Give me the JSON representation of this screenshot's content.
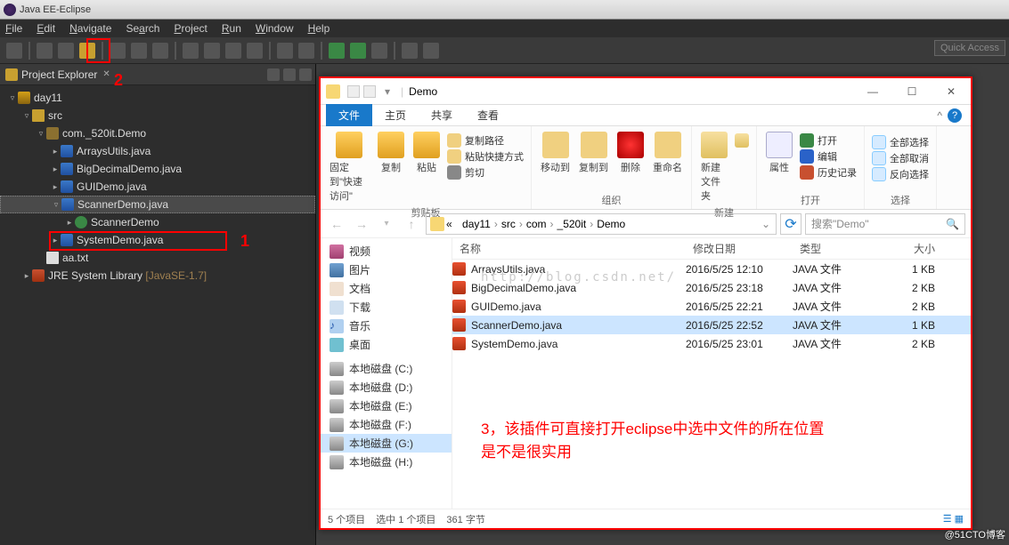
{
  "title": {
    "appname": "Java EE",
    "separator": " - ",
    "ide": "Eclipse"
  },
  "menu": [
    "File",
    "Edit",
    "Navigate",
    "Search",
    "Project",
    "Run",
    "Window",
    "Help"
  ],
  "quick_access": "Quick Access",
  "annotations": {
    "a1": "1",
    "a2": "2",
    "a3_line1": "3，该插件可直接打开eclipse中选中文件的所在位置",
    "a3_line2": "是不是很实用"
  },
  "pe": {
    "title": "Project Explorer"
  },
  "tree": {
    "project": "day11",
    "src": "src",
    "pkg": "com._520it.Demo",
    "files": [
      "ArraysUtils.java",
      "BigDecimalDemo.java",
      "GUIDemo.java",
      "ScannerDemo.java",
      "SystemDemo.java"
    ],
    "inner": "ScannerDemo",
    "txt": "aa.txt",
    "jre_lbl": "JRE System Library",
    "jre_ver": "[JavaSE-1.7]"
  },
  "explorer": {
    "title": "Demo",
    "tabs": [
      "文件",
      "主页",
      "共享",
      "查看"
    ],
    "ribbon": {
      "pin": "固定到\"快速访问\"",
      "copy": "复制",
      "paste": "粘贴",
      "cut": "剪切",
      "copypath": "复制路径",
      "pasteshort": "粘贴快捷方式",
      "clip_grp": "剪贴板",
      "moveto": "移动到",
      "copyto": "复制到",
      "delete": "删除",
      "rename": "重命名",
      "org_grp": "组织",
      "newfolder": "新建文件夹",
      "new_grp": "新建",
      "props": "属性",
      "open": "打开",
      "edit": "编辑",
      "history": "历史记录",
      "open_grp": "打开",
      "selall": "全部选择",
      "selnone": "全部取消",
      "selinv": "反向选择",
      "sel_grp": "选择"
    },
    "breadcrumb": [
      "day11",
      "src",
      "com",
      "_520it",
      "Demo"
    ],
    "bc_prefix": "«",
    "search": "搜索\"Demo\"",
    "navtree": [
      "视频",
      "图片",
      "文档",
      "下载",
      "音乐",
      "桌面"
    ],
    "drives": [
      "本地磁盘 (C:)",
      "本地磁盘 (D:)",
      "本地磁盘 (E:)",
      "本地磁盘 (F:)",
      "本地磁盘 (G:)",
      "本地磁盘 (H:)"
    ],
    "cols": {
      "name": "名称",
      "date": "修改日期",
      "type": "类型",
      "size": "大小"
    },
    "files": [
      {
        "name": "ArraysUtils.java",
        "date": "2016/5/25 12:10",
        "type": "JAVA 文件",
        "size": "1 KB"
      },
      {
        "name": "BigDecimalDemo.java",
        "date": "2016/5/25 23:18",
        "type": "JAVA 文件",
        "size": "2 KB"
      },
      {
        "name": "GUIDemo.java",
        "date": "2016/5/25 22:21",
        "type": "JAVA 文件",
        "size": "2 KB"
      },
      {
        "name": "ScannerDemo.java",
        "date": "2016/5/25 22:52",
        "type": "JAVA 文件",
        "size": "1 KB",
        "selected": true
      },
      {
        "name": "SystemDemo.java",
        "date": "2016/5/25 23:01",
        "type": "JAVA 文件",
        "size": "2 KB"
      }
    ],
    "status": {
      "count": "5 个项目",
      "selected": "选中 1 个项目",
      "bytes": "361 字节"
    }
  },
  "watermark": "http://blog.csdn.net/",
  "attribution": "@51CTO博客"
}
